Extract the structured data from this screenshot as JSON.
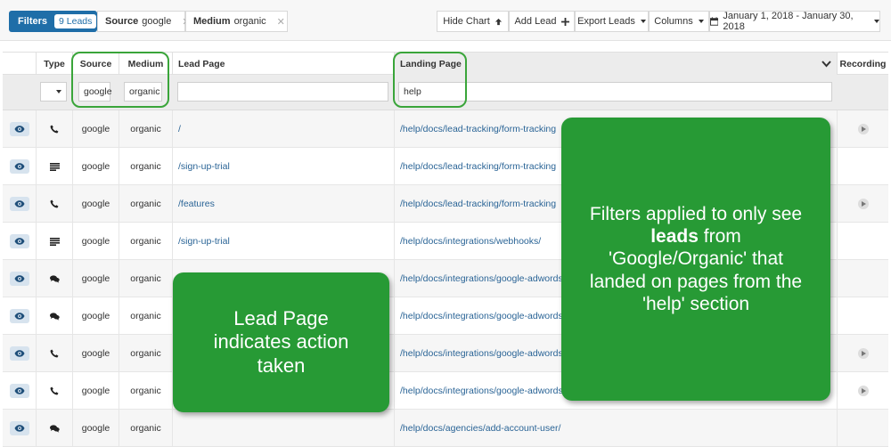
{
  "toolbar": {
    "filters_label": "Filters",
    "leads_count": "9 Leads",
    "chips": [
      {
        "key": "Source",
        "value": "google",
        "remove": "✕"
      },
      {
        "key": "Medium",
        "value": "organic",
        "remove": "✕"
      }
    ],
    "hide_chart": "Hide Chart",
    "add_lead": "Add Lead",
    "export_leads": "Export Leads",
    "columns": "Columns",
    "date_range": "January 1, 2018 - January 30, 2018"
  },
  "table": {
    "headers": {
      "type": "Type",
      "source": "Source",
      "medium": "Medium",
      "lead_page": "Lead Page",
      "landing_page": "Landing Page",
      "recording": "Recording"
    },
    "filters": {
      "type_value": "",
      "source": "google",
      "medium": "organic",
      "lead_page": "",
      "landing_page": "help"
    },
    "rows": [
      {
        "type_icon": "phone-icon",
        "source": "google",
        "medium": "organic",
        "lead_page": "/",
        "landing_page": "/help/docs/lead-tracking/form-tracking",
        "recording": true
      },
      {
        "type_icon": "form-icon",
        "source": "google",
        "medium": "organic",
        "lead_page": "/sign-up-trial",
        "landing_page": "/help/docs/lead-tracking/form-tracking",
        "recording": false
      },
      {
        "type_icon": "phone-icon",
        "source": "google",
        "medium": "organic",
        "lead_page": "/features",
        "landing_page": "/help/docs/lead-tracking/form-tracking",
        "recording": true
      },
      {
        "type_icon": "form-icon",
        "source": "google",
        "medium": "organic",
        "lead_page": "/sign-up-trial",
        "landing_page": "/help/docs/integrations/webhooks/",
        "recording": false
      },
      {
        "type_icon": "chat-icon",
        "source": "google",
        "medium": "organic",
        "lead_page": "",
        "landing_page": "/help/docs/integrations/google-adwords",
        "recording": false
      },
      {
        "type_icon": "chat-icon",
        "source": "google",
        "medium": "organic",
        "lead_page": "",
        "landing_page": "/help/docs/integrations/google-adwords",
        "recording": false
      },
      {
        "type_icon": "phone-icon",
        "source": "google",
        "medium": "organic",
        "lead_page": "",
        "landing_page": "/help/docs/integrations/google-adwords",
        "recording": true
      },
      {
        "type_icon": "phone-icon",
        "source": "google",
        "medium": "organic",
        "lead_page": "",
        "landing_page": "/help/docs/integrations/google-adwords",
        "recording": true
      },
      {
        "type_icon": "chat-icon",
        "source": "google",
        "medium": "organic",
        "lead_page": "",
        "landing_page": "/help/docs/agencies/add-account-user/",
        "recording": false
      }
    ]
  },
  "callouts": {
    "lead_page": "Lead Page indicates action taken",
    "filters_prefix": "Filters applied to only see",
    "filters_bold": "leads",
    "filters_suffix": "from 'Google/Organic' that landed on pages from the 'help' section"
  },
  "colors": {
    "primary": "#1f6ea8",
    "callout_green": "#279a35",
    "highlight_green": "#3aa53a",
    "link": "#2a6496"
  }
}
